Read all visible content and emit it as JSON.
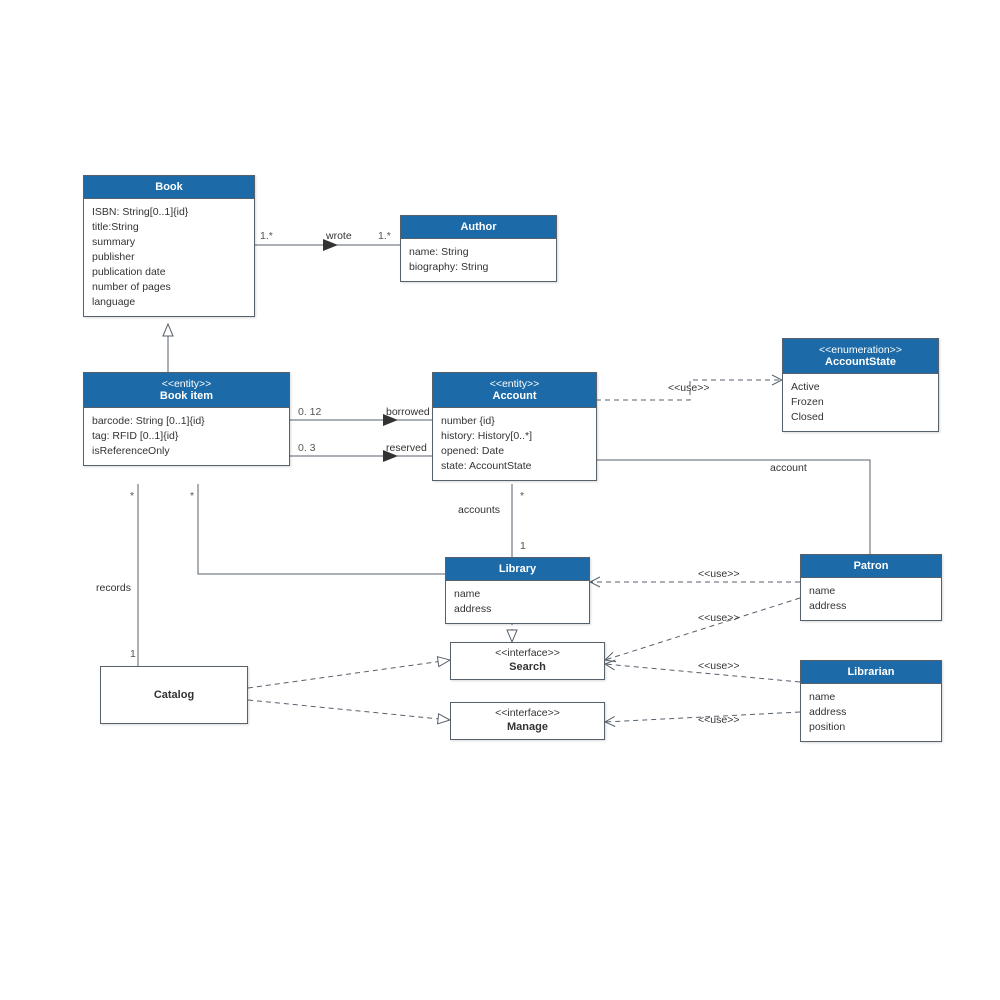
{
  "classes": {
    "book": {
      "title": "Book",
      "attrs": [
        "ISBN: String[0..1]{id}",
        "title:String",
        "summary",
        "publisher",
        "publication date",
        "number of pages",
        "language"
      ]
    },
    "author": {
      "title": "Author",
      "attrs": [
        "name: String",
        "biography: String"
      ]
    },
    "bookItem": {
      "stereo": "<<entity>>",
      "title": "Book item",
      "attrs": [
        "barcode: String [0..1]{id}",
        "tag: RFID [0..1]{id}",
        "isReferenceOnly"
      ]
    },
    "account": {
      "stereo": "<<entity>>",
      "title": "Account",
      "attrs": [
        "number {id}",
        "history: History[0..*]",
        "opened: Date",
        "state: AccountState"
      ]
    },
    "accountState": {
      "stereo": "<<enumeration>>",
      "title": "AccountState",
      "attrs": [
        "Active",
        "Frozen",
        "Closed"
      ]
    },
    "library": {
      "title": "Library",
      "attrs": [
        "name",
        "address"
      ]
    },
    "patron": {
      "title": "Patron",
      "attrs": [
        "name",
        "address"
      ]
    },
    "librarian": {
      "title": "Librarian",
      "attrs": [
        "name",
        "address",
        "position"
      ]
    },
    "catalog": {
      "title": "Catalog"
    },
    "search": {
      "stereo": "<<interface>>",
      "title": "Search"
    },
    "manage": {
      "stereo": "<<interface>>",
      "title": "Manage"
    }
  },
  "labels": {
    "wrote": "wrote",
    "borrowed": "borrowed",
    "reserved": "reserved",
    "use": "<<use>>",
    "records": "records",
    "accounts": "accounts",
    "account": "account"
  },
  "mult": {
    "m1star_a": "1.*",
    "m1star_b": "1.*",
    "m012": "0. 12",
    "m03": "0. 3",
    "star": "*",
    "one": "1"
  }
}
